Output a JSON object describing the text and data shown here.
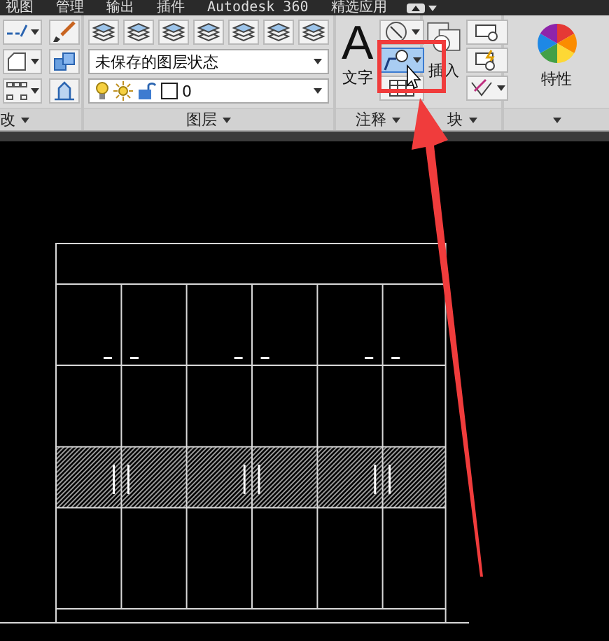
{
  "menu_tabs": [
    {
      "label": "视图",
      "selected": false
    },
    {
      "label": "管理",
      "selected": false
    },
    {
      "label": "输出",
      "selected": false
    },
    {
      "label": "插件",
      "selected": false
    },
    {
      "label": "Autodesk 360",
      "selected": false
    },
    {
      "label": "精选应用",
      "selected": false
    }
  ],
  "ribbon": {
    "modify_panel": {
      "label": "改"
    },
    "layers_panel": {
      "label": "图层",
      "layer_state": "未保存的图层状态",
      "current_layer": "0"
    },
    "annotation_panel": {
      "label": "注释",
      "text_icon": "A",
      "text_button": "文字",
      "leader_button": {
        "hovered": true
      }
    },
    "block_panel": {
      "label": "块",
      "insert_button": "插入"
    },
    "properties_panel": {
      "label": "特性"
    }
  },
  "callout": {
    "kind": "arrow",
    "color": "#f03c3c"
  }
}
